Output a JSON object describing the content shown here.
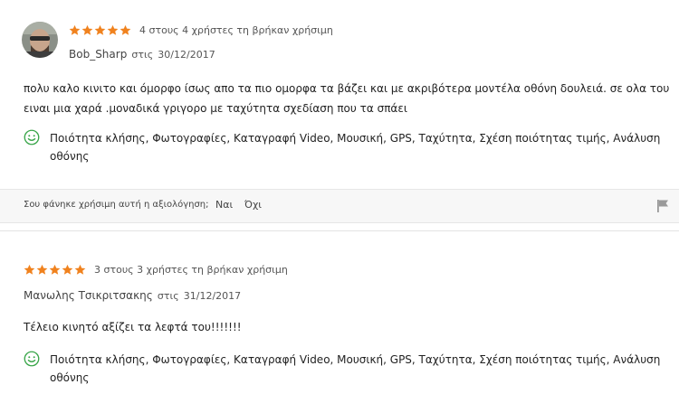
{
  "colors": {
    "star": "#f0821e",
    "pros_icon": "#3aa64a",
    "flag": "#9a9a9a"
  },
  "reviews": [
    {
      "rating": 5,
      "helpful": "4 στους 4 χρήστες τη βρήκαν χρήσιμη",
      "author": "Bob_Sharp",
      "on_label": "στις",
      "date": "30/12/2017",
      "text": "πολυ καλο κινιτο και όμορφο ίσως απο τα πιο ομορφα τα βάζει και με ακριβότερα μοντέλα οθόνη δουλειά. σε ολα του ειναι μια χαρά .μοναδικά γριγορο με ταχύτητα σχεδίαση που τα σπάει",
      "pros_icon": "smiley-icon",
      "pros": "Ποιότητα κλήσης, Φωτογραφίες, Καταγραφή Video, Μουσική, GPS, Ταχύτητα, Σχέση ποιότητας τιμής, Ανάλυση οθόνης"
    },
    {
      "rating": 5,
      "helpful": "3 στους 3 χρήστες τη βρήκαν χρήσιμη",
      "author": "Μανωλης Τσικριτσακης",
      "on_label": "στις",
      "date": "31/12/2017",
      "text": "Τέλειο κινητό αξίζει τα λεφτά του!!!!!!!",
      "pros_icon": "smiley-icon",
      "pros": "Ποιότητα κλήσης, Φωτογραφίες, Καταγραφή Video, Μουσική, GPS, Ταχύτητα, Σχέση ποιότητας τιμής, Ανάλυση οθόνης"
    }
  ],
  "helpful_bar": {
    "question": "Σου φάνηκε χρήσιμη αυτή η αξιολόγηση;",
    "yes": "Ναι",
    "no": "Όχι",
    "flag_icon": "flag-icon"
  }
}
